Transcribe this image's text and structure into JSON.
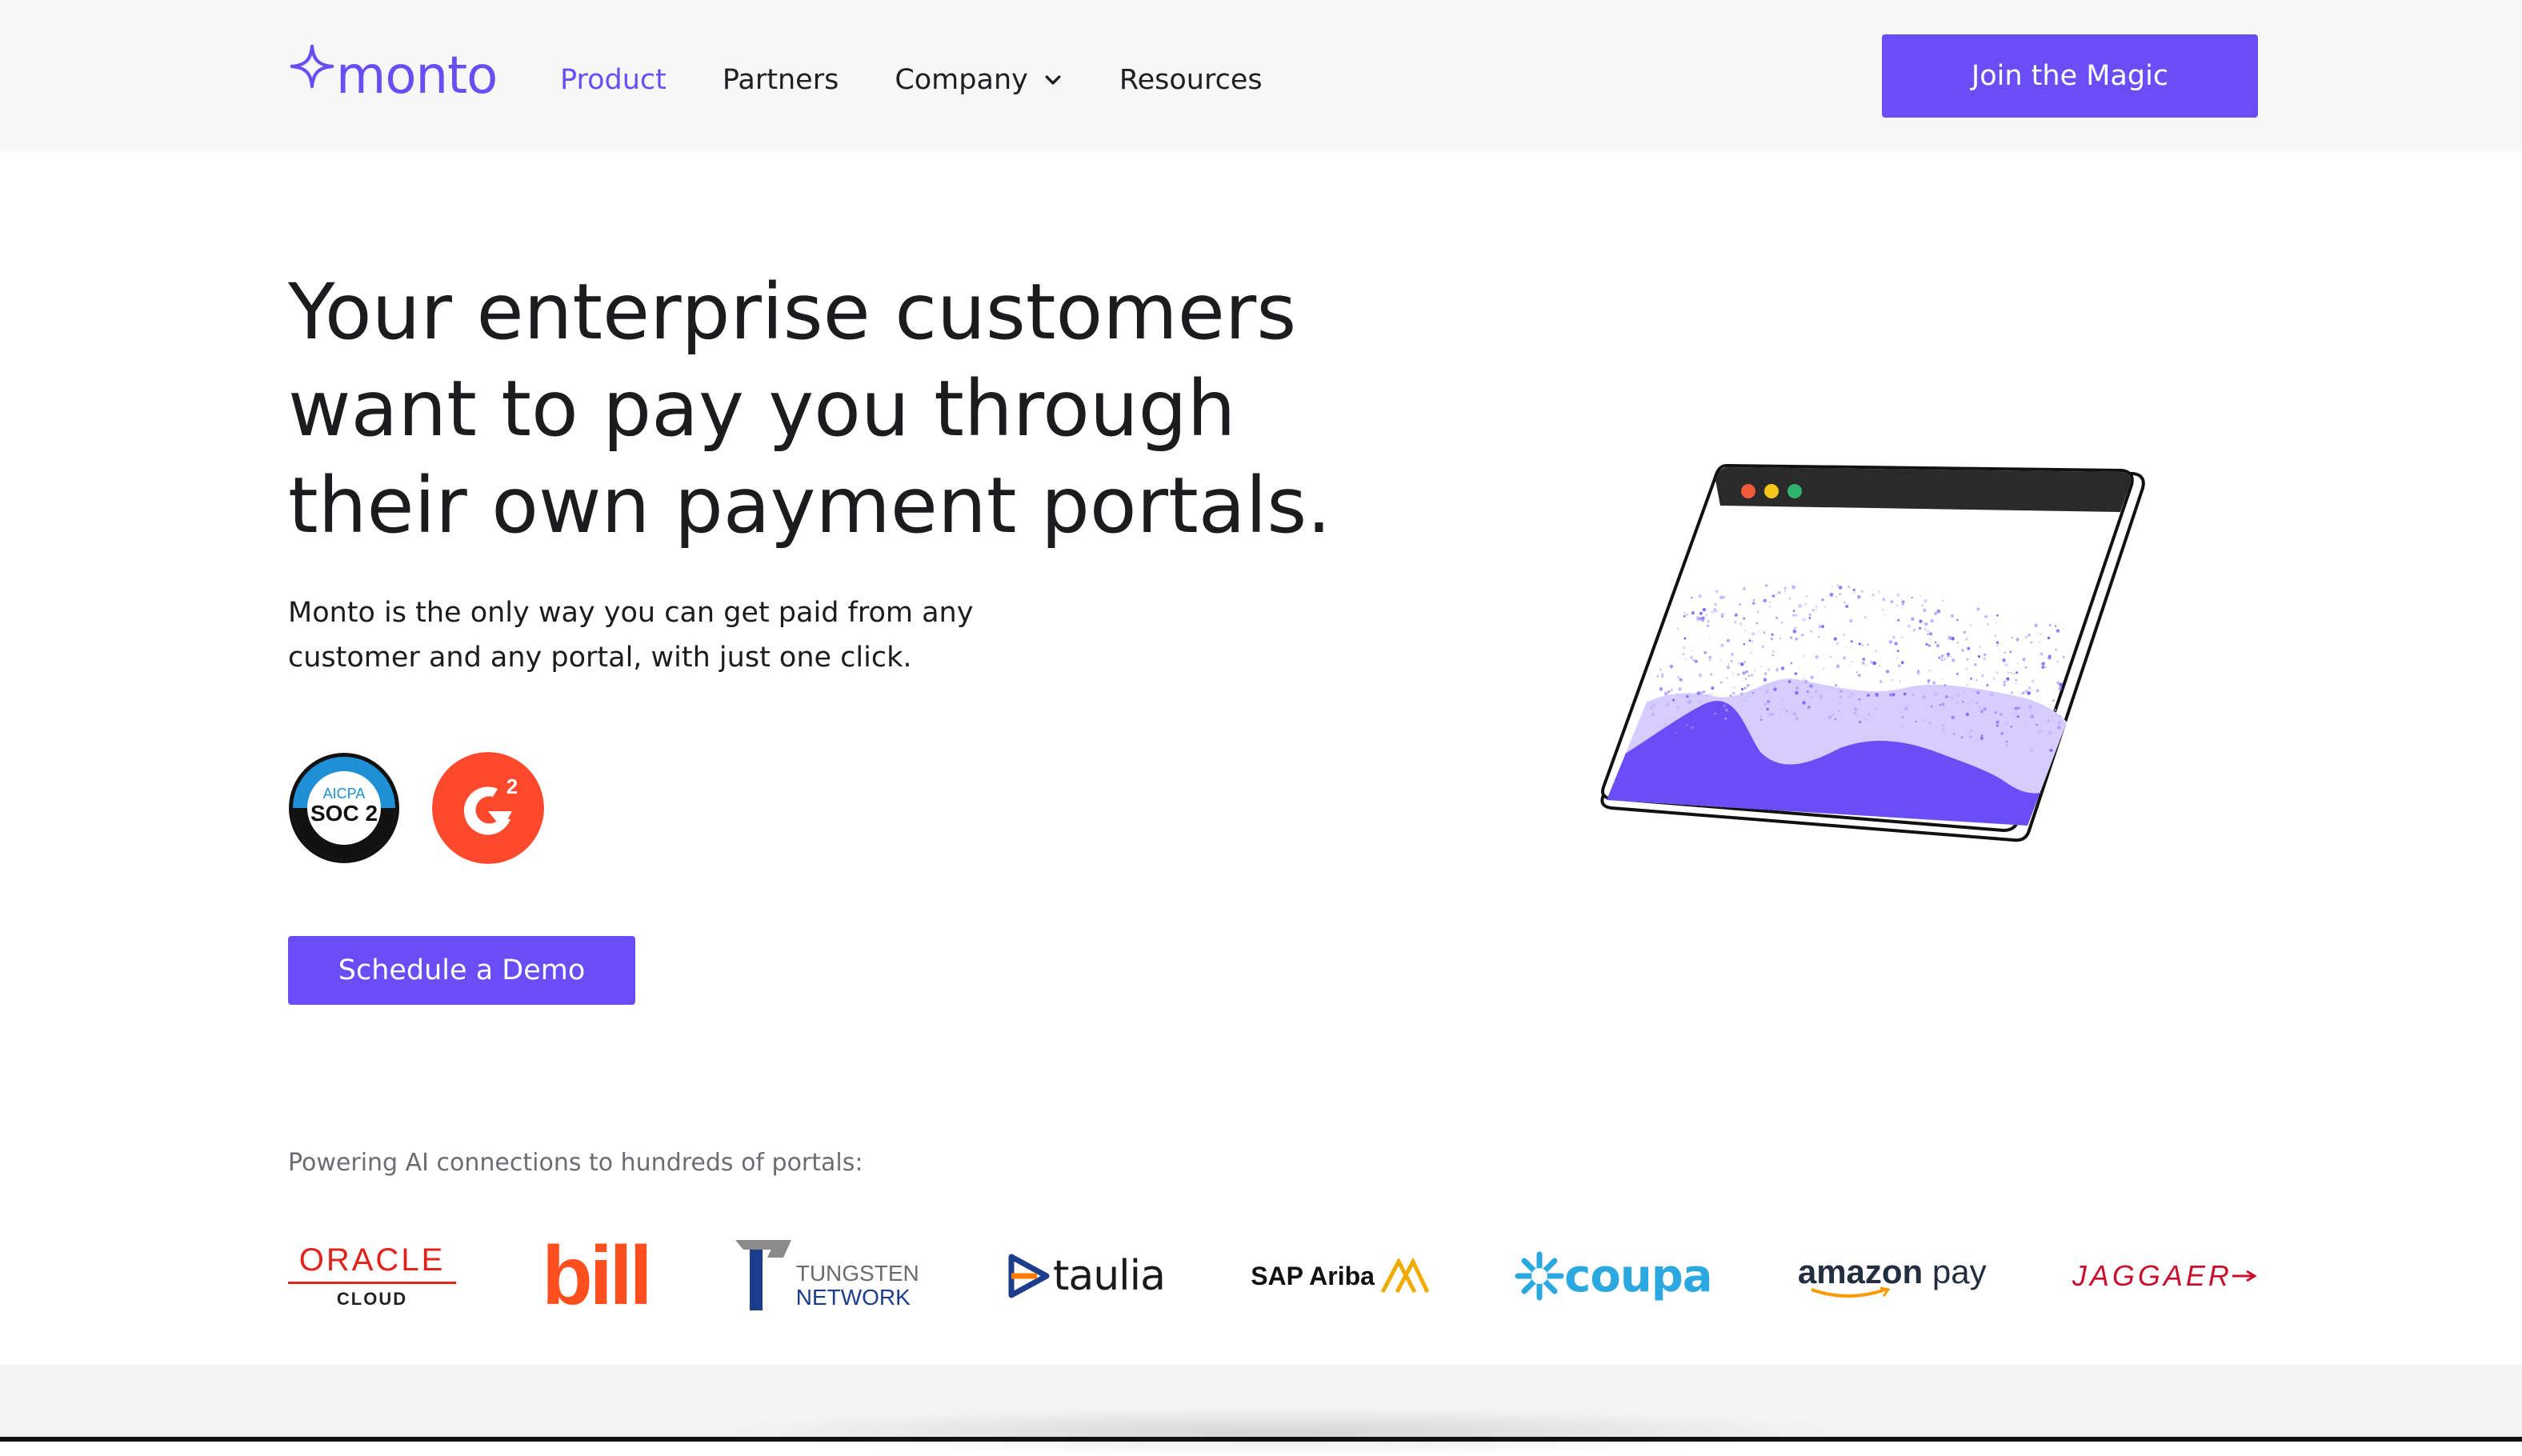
{
  "brand": {
    "name": "monto",
    "accent": "#6a4df5"
  },
  "nav": {
    "items": [
      {
        "label": "Product",
        "active": true
      },
      {
        "label": "Partners",
        "active": false
      },
      {
        "label": "Company",
        "active": false,
        "dropdown": true
      },
      {
        "label": "Resources",
        "active": false
      }
    ],
    "cta_label": "Join the Magic"
  },
  "hero": {
    "title_lines": [
      "Your enterprise customers",
      "want to pay you through",
      "their own payment portals."
    ],
    "subtitle_lines": [
      "Monto is the only way you can get paid from any",
      "customer and any portal, with just one click."
    ],
    "badges": [
      {
        "name": "soc2-badge",
        "top": "AICPA",
        "main": "SOC 2"
      },
      {
        "name": "g2-badge",
        "text": "G2"
      }
    ],
    "demo_label": "Schedule a Demo"
  },
  "portals": {
    "heading": "Powering AI connections to hundreds of portals:",
    "oracle": {
      "line1": "ORACLE",
      "line2": "CLOUD"
    },
    "bill": "bill",
    "tungsten": {
      "line1": "TUNGSTEN",
      "line2": "NETWORK"
    },
    "taulia": "taulia",
    "ariba": "SAP Ariba",
    "coupa": "coupa",
    "amazon": {
      "part1": "amazon",
      "part2": " pay"
    },
    "jaggaer": "JAGGAER"
  },
  "colors": {
    "nav_bg": "#f7f7f7",
    "bill_orange": "#ff4f1f",
    "g2_red": "#ff492c",
    "coupa_blue": "#2ba8e0"
  }
}
